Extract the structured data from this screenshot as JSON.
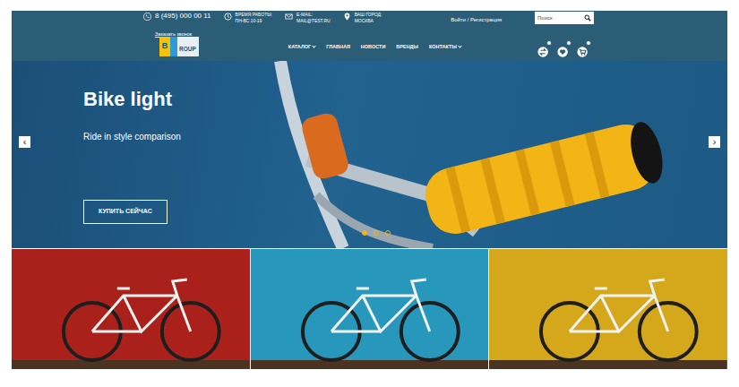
{
  "header": {
    "phone": "8 (495) 000 00 11",
    "callback": "Заказать звонок",
    "hours": {
      "label": "ВРЕМЯ РАБОТЫ:",
      "value": "ПН-ВС 10-19"
    },
    "email": {
      "label": "E-MAIL:",
      "value": "MAIL@TEST.RU"
    },
    "city": {
      "label": "ВАШ ГОРОД:",
      "value": "МОСКВА"
    },
    "login": "Войти / Регистрация",
    "search": {
      "placeholder": "Поиск"
    }
  },
  "logo": {
    "mark": "B",
    "text": "ROUP"
  },
  "nav": [
    {
      "label": "КАТАЛОГ",
      "has_menu": true
    },
    {
      "label": "ГЛАВНАЯ",
      "has_menu": false
    },
    {
      "label": "НОВОСТИ",
      "has_menu": false
    },
    {
      "label": "БРЕНДЫ",
      "has_menu": false
    },
    {
      "label": "КОНТАКТЫ",
      "has_menu": true
    }
  ],
  "slider": {
    "title": "Bike light",
    "subtitle": "Ride in style comparison",
    "button": "КУПИТЬ СЕЙЧАС",
    "prev": "‹",
    "next": "›",
    "dots": [
      {
        "selected": true
      },
      {
        "selected": false
      },
      {
        "selected": false
      }
    ]
  },
  "tiles": [
    {
      "color": "#b5241e"
    },
    {
      "color": "#2aa2c8"
    },
    {
      "color": "#e3b21c"
    }
  ]
}
